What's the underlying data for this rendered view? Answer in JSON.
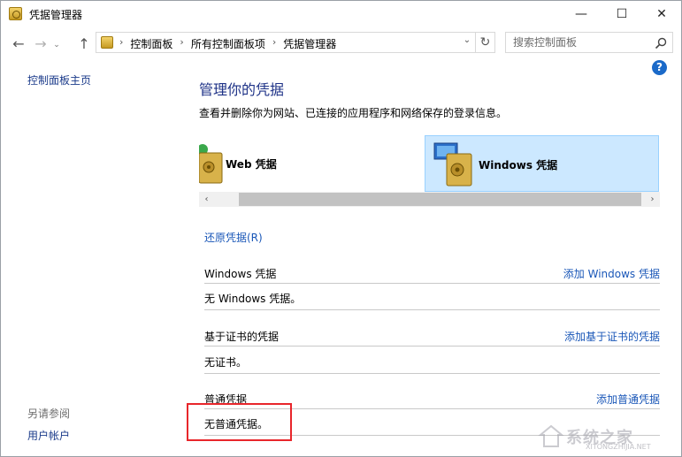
{
  "window": {
    "title": "凭据管理器",
    "minimize_glyph": "—",
    "maximize_glyph": "☐",
    "close_glyph": "✕"
  },
  "nav": {
    "back_glyph": "←",
    "forward_glyph": "→",
    "history_glyph": "⌄",
    "up_glyph": "↑",
    "breadcrumbs": [
      "控制面板",
      "所有控制面板项",
      "凭据管理器"
    ],
    "breadcrumb_separator": "›",
    "dropdown_glyph": "⌄",
    "refresh_glyph": "↻"
  },
  "search": {
    "placeholder": "搜索控制面板"
  },
  "help_glyph": "?",
  "sidebar": {
    "home_label": "控制面板主页",
    "see_also_label": "另请参阅",
    "user_accounts_label": "用户帐户"
  },
  "main": {
    "title": "管理你的凭据",
    "description": "查看并删除你为网站、已连接的应用程序和网络保存的登录信息。",
    "vaults": [
      {
        "label": "Web 凭据",
        "selected": false
      },
      {
        "label": "Windows 凭据",
        "selected": true
      }
    ],
    "scroll_left_glyph": "‹",
    "scroll_right_glyph": "›",
    "restore_link": "还原凭据(R)",
    "sections": [
      {
        "title": "Windows 凭据",
        "add_link": "添加 Windows 凭据",
        "empty_text": "无 Windows 凭据。"
      },
      {
        "title": "基于证书的凭据",
        "add_link": "添加基于证书的凭据",
        "empty_text": "无证书。"
      },
      {
        "title": "普通凭据",
        "add_link": "添加普通凭据",
        "empty_text": "无普通凭据。"
      }
    ]
  },
  "watermark": {
    "text": "系统之家",
    "url": "XITONGZHIJIA.NET"
  },
  "colors": {
    "link": "#1a57b8",
    "title": "#1e3287",
    "selected_tile": "#cce8ff",
    "highlight": "#e8262b"
  }
}
